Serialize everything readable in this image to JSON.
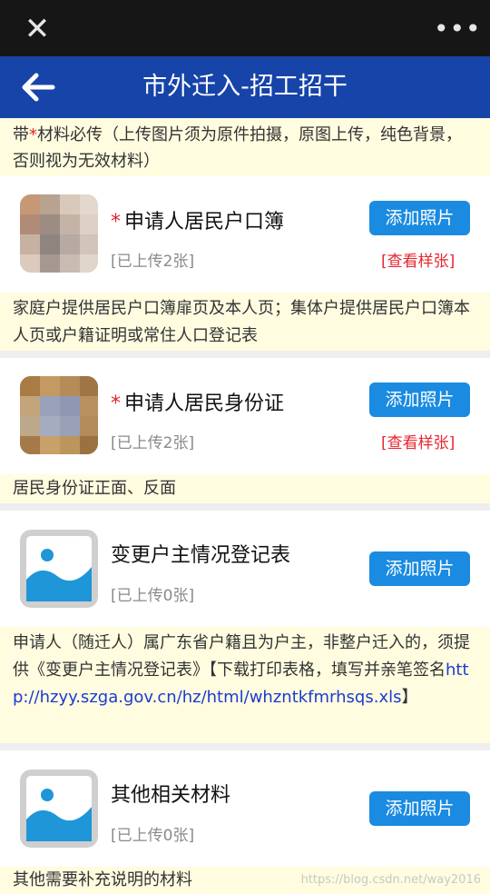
{
  "topbar": {
    "close_icon": "close-icon",
    "more_icon": "more-icon"
  },
  "header": {
    "title": "市外迁入-招工招干",
    "back_icon": "arrow-left-icon"
  },
  "notice": {
    "prefix": "带",
    "star": "*",
    "text": "材料必传（上传图片须为原件拍摄，原图上传，纯色背景，否则视为无效材料）"
  },
  "items": [
    {
      "required_mark": "*",
      "name": "申请人居民户口簿",
      "count": "[已上传2张]",
      "add_label": "添加照片",
      "sample_label": "[查看样张]",
      "desc": "家庭户提供居民户口簿扉页及本人页；集体户提供居民户口簿本人页或户籍证明或常住人口登记表"
    },
    {
      "required_mark": "*",
      "name": "申请人居民身份证",
      "count": "[已上传2张]",
      "add_label": "添加照片",
      "sample_label": "[查看样张]",
      "desc": "居民身份证正面、反面"
    },
    {
      "name": "变更户主情况登记表",
      "count": "[已上传0张]",
      "add_label": "添加照片",
      "desc_text": "申请人（随迁人）属广东省户籍且为户主，非整户迁入的，须提供《变更户主情况登记表》【下载打印表格，填写并亲笔签名",
      "desc_link": "http://hzyy.szga.gov.cn/hz/html/whzntkfmrhsqs.xls",
      "desc_tail": "】"
    },
    {
      "name": "其他相关材料",
      "count": "[已上传0张]",
      "add_label": "添加照片",
      "desc": "其他需要补充说明的材料"
    }
  ],
  "watermark": "https://blog.csdn.net/way2016",
  "colors": {
    "header_bg": "#1744a9",
    "button_bg": "#1a8be0",
    "required_red": "#e0232d",
    "notice_bg": "#fffce0"
  }
}
